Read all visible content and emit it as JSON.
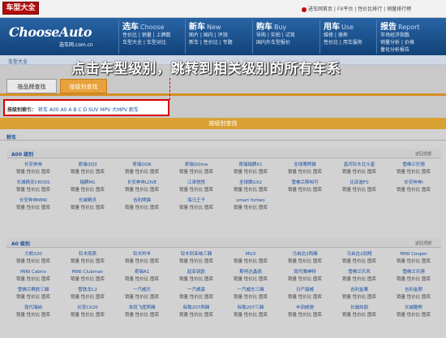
{
  "brand_tab": "车型大全",
  "top_links": "进车网首页 | FX平台 | 性价比排行 | 销量排行榜",
  "logo": {
    "main": "ChooseAuto",
    "sub": "选车网.com.cn"
  },
  "menu": [
    {
      "title": "选车",
      "en": "Choose",
      "rows": [
        "性价比 | 销量 | 上牌数",
        "车型大全 | 车型对比"
      ]
    },
    {
      "title": "新车",
      "en": "New",
      "rows": [
        "图片 | 国内 | 评测",
        "新车 | 性价比 | 专题"
      ]
    },
    {
      "title": "购车",
      "en": "Buy",
      "rows": [
        "导购 | 实拍 | 试驾",
        "国内外车型报价"
      ]
    },
    {
      "title": "用车",
      "en": "Use",
      "rows": [
        "维修 | 保养",
        "性价比 | 用车服务"
      ]
    },
    {
      "title": "报告",
      "en": "Report",
      "rows": [
        "市场经济指数",
        "销量分析 | 价格",
        "量化分析报告"
      ]
    }
  ],
  "breadcrumb": "车型大全",
  "annotation": "点击车型级别，跳转到相关级别的所有车系",
  "tabs": {
    "tab1": "按品牌查找",
    "tab2": "按级别查找"
  },
  "index": {
    "label": "按级别索引：",
    "links": "轿车 A00 A0 A B C D SUV MPV 大MPV 跑车"
  },
  "section_title": "按级别查找",
  "category": "轿车",
  "back_top": "返回顶部",
  "links_text": "销量 性价比 图库",
  "groups": [
    {
      "title": "A00 级别",
      "cars": [
        "长安奔奔",
        "奇瑞QQ3",
        "奇瑞QQ6",
        "奇瑞QQme",
        "奇瑞瑞麒X1",
        "全球鹰熊猫",
        "昌河铃木北斗星",
        "雪佛兰乐驰",
        "长城精灵CROSS",
        "瑞麒M1",
        "长安奔奔LOVE",
        "江淮悦悦",
        "全球鹰GX2",
        "雪佛兰斯帕可",
        "比亚迪F0",
        "长安奔奔i",
        "长安奔奔MINI",
        "长城精灵",
        "吉利熊猫",
        "海马王子",
        "smart fortwo"
      ]
    },
    {
      "title": "A0 级别",
      "cars": [
        "力帆320",
        "铃木雨燕",
        "铃木羚羊",
        "铃木利亚纳三厢",
        "MG3",
        "马自达2两厢",
        "马自达2劲翔",
        "MINI Cooper",
        "MINI Cabrio",
        "MINI Clubman",
        "奇瑞A1",
        "起亚锐欧",
        "斯柯达晶锐",
        "现代雅绅特",
        "雪佛兰乐风",
        "雪佛兰乐骋",
        "雪佛兰赛欧三厢",
        "雪铁龙C2",
        "一汽威乐",
        "一汽威姿",
        "一汽威志三厢",
        "日产骊威",
        "吉利金鹰",
        "吉利金刚",
        "现代瑞纳",
        "长安CX20",
        "本田飞度两厢",
        "标致207两厢",
        "标致207三厢",
        "丰田威驰",
        "长城炫丽",
        "长城酷熊"
      ]
    }
  ]
}
